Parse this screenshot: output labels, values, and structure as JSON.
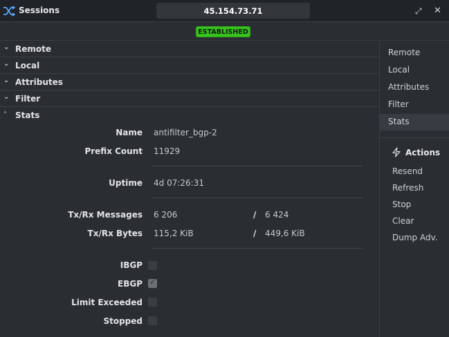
{
  "window": {
    "title": "Sessions",
    "address": "45.154.73.71",
    "status": "ESTABLISHED",
    "accent_color": "#38c21e"
  },
  "sections": [
    {
      "label": "Remote",
      "expanded": false
    },
    {
      "label": "Local",
      "expanded": false
    },
    {
      "label": "Attributes",
      "expanded": false
    },
    {
      "label": "Filter",
      "expanded": false
    },
    {
      "label": "Stats",
      "expanded": true
    }
  ],
  "stats": {
    "name_label": "Name",
    "name_value": "antifilter_bgp-2",
    "prefix_label": "Prefix Count",
    "prefix_value": "11929",
    "uptime_label": "Uptime",
    "uptime_value": "4d 07:26:31",
    "messages_label": "Tx/Rx Messages",
    "messages_tx": "6 206",
    "messages_sep": "/",
    "messages_rx": "6 424",
    "bytes_label": "Tx/Rx Bytes",
    "bytes_tx": "115,2 KiB",
    "bytes_sep": "/",
    "bytes_rx": "449,6 KiB",
    "flags": [
      {
        "label": "IBGP",
        "checked": false
      },
      {
        "label": "EBGP",
        "checked": true
      },
      {
        "label": "Limit Exceeded",
        "checked": false
      },
      {
        "label": "Stopped",
        "checked": false
      }
    ]
  },
  "nav": {
    "items": [
      "Remote",
      "Local",
      "Attributes",
      "Filter",
      "Stats"
    ],
    "active": "Stats"
  },
  "actions": {
    "heading": "Actions",
    "items": [
      "Resend",
      "Refresh",
      "Stop",
      "Clear",
      "Dump Adv."
    ]
  },
  "icons": {
    "app": "shuffle-icon",
    "expand": "expand-icon",
    "close": "close-icon",
    "actions": "lightning-bolt-icon"
  }
}
